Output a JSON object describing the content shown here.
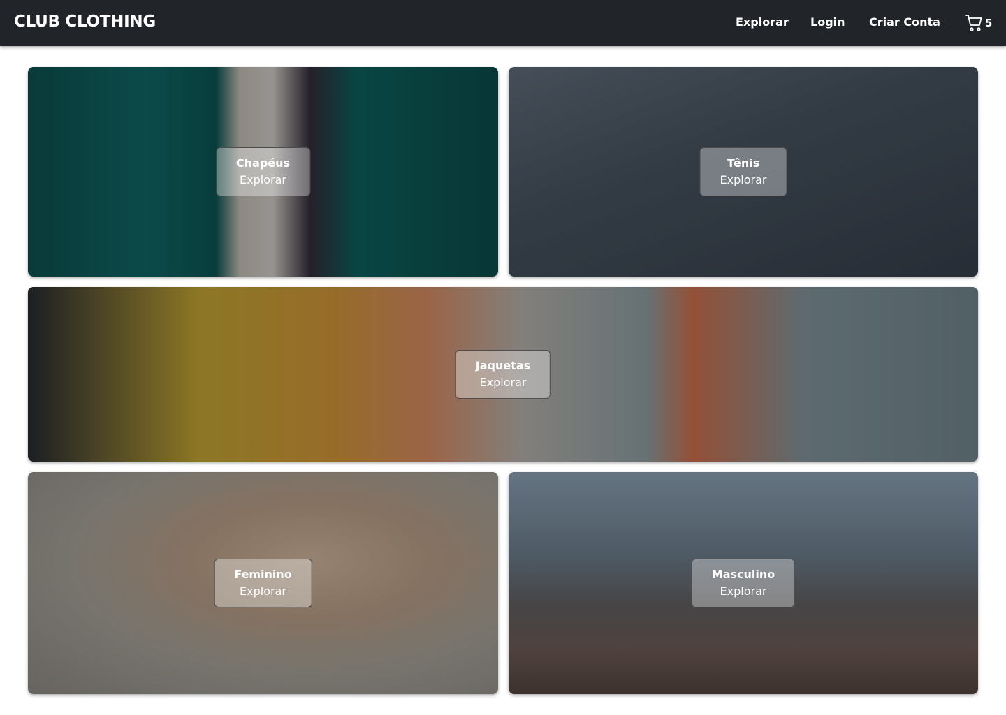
{
  "header": {
    "logo": "CLUB CLOTHING",
    "nav": [
      "Explorar",
      "Login",
      "Criar Conta"
    ],
    "cart_icon": "shopping-cart-icon",
    "cart_count": "5"
  },
  "categories": [
    {
      "title": "Chapéus",
      "action": "Explorar"
    },
    {
      "title": "Tênis",
      "action": "Explorar"
    },
    {
      "title": "Jaquetas",
      "action": "Explorar"
    },
    {
      "title": "Feminino",
      "action": "Explorar"
    },
    {
      "title": "Masculino",
      "action": "Explorar"
    }
  ],
  "colors": {
    "header_bg": "#212429",
    "text_light": "#ffffff"
  }
}
